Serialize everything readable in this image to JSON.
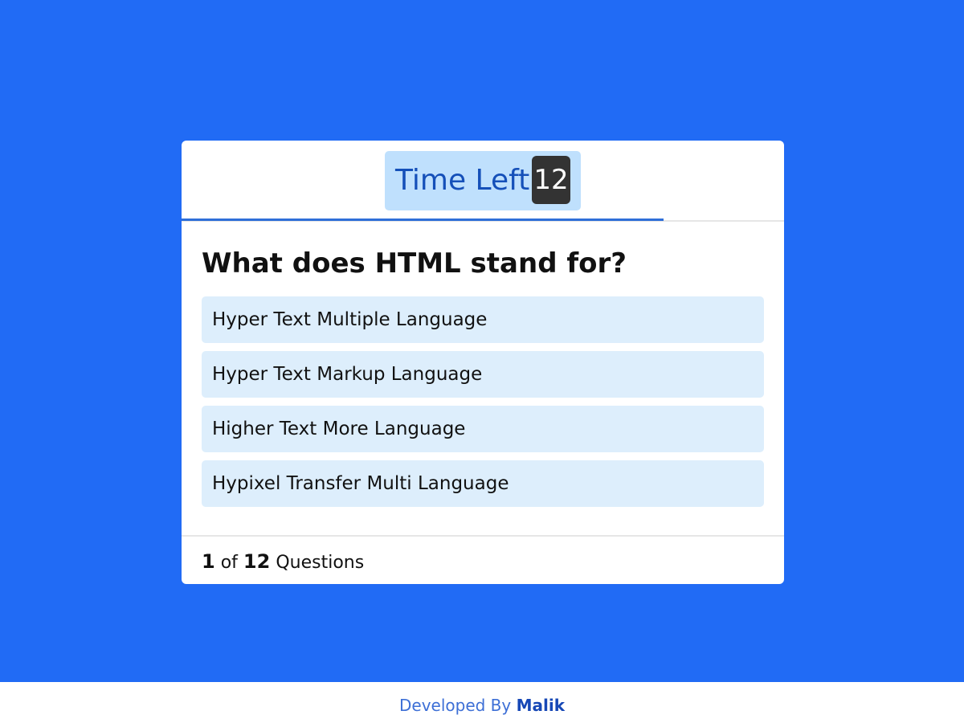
{
  "timer": {
    "label": "Time Left",
    "value": "12",
    "progress": 0.8
  },
  "question": {
    "text": "What does HTML stand for?",
    "options": [
      "Hyper Text Multiple Language",
      "Hyper Text Markup Language",
      "Higher Text More Language",
      "Hypixel Transfer Multi Language"
    ]
  },
  "counter": {
    "current": "1",
    "of_text": "of",
    "total": "12",
    "suffix": "Questions"
  },
  "footer": {
    "prefix": "Developed By",
    "author": "Malik"
  },
  "colors": {
    "background": "#216bf5",
    "timer_bg": "#bfe0fd",
    "timer_text": "#1550b9",
    "timer_count_bg": "#333333",
    "option_bg": "#ddeefc",
    "progress": "#2f6fd8"
  }
}
